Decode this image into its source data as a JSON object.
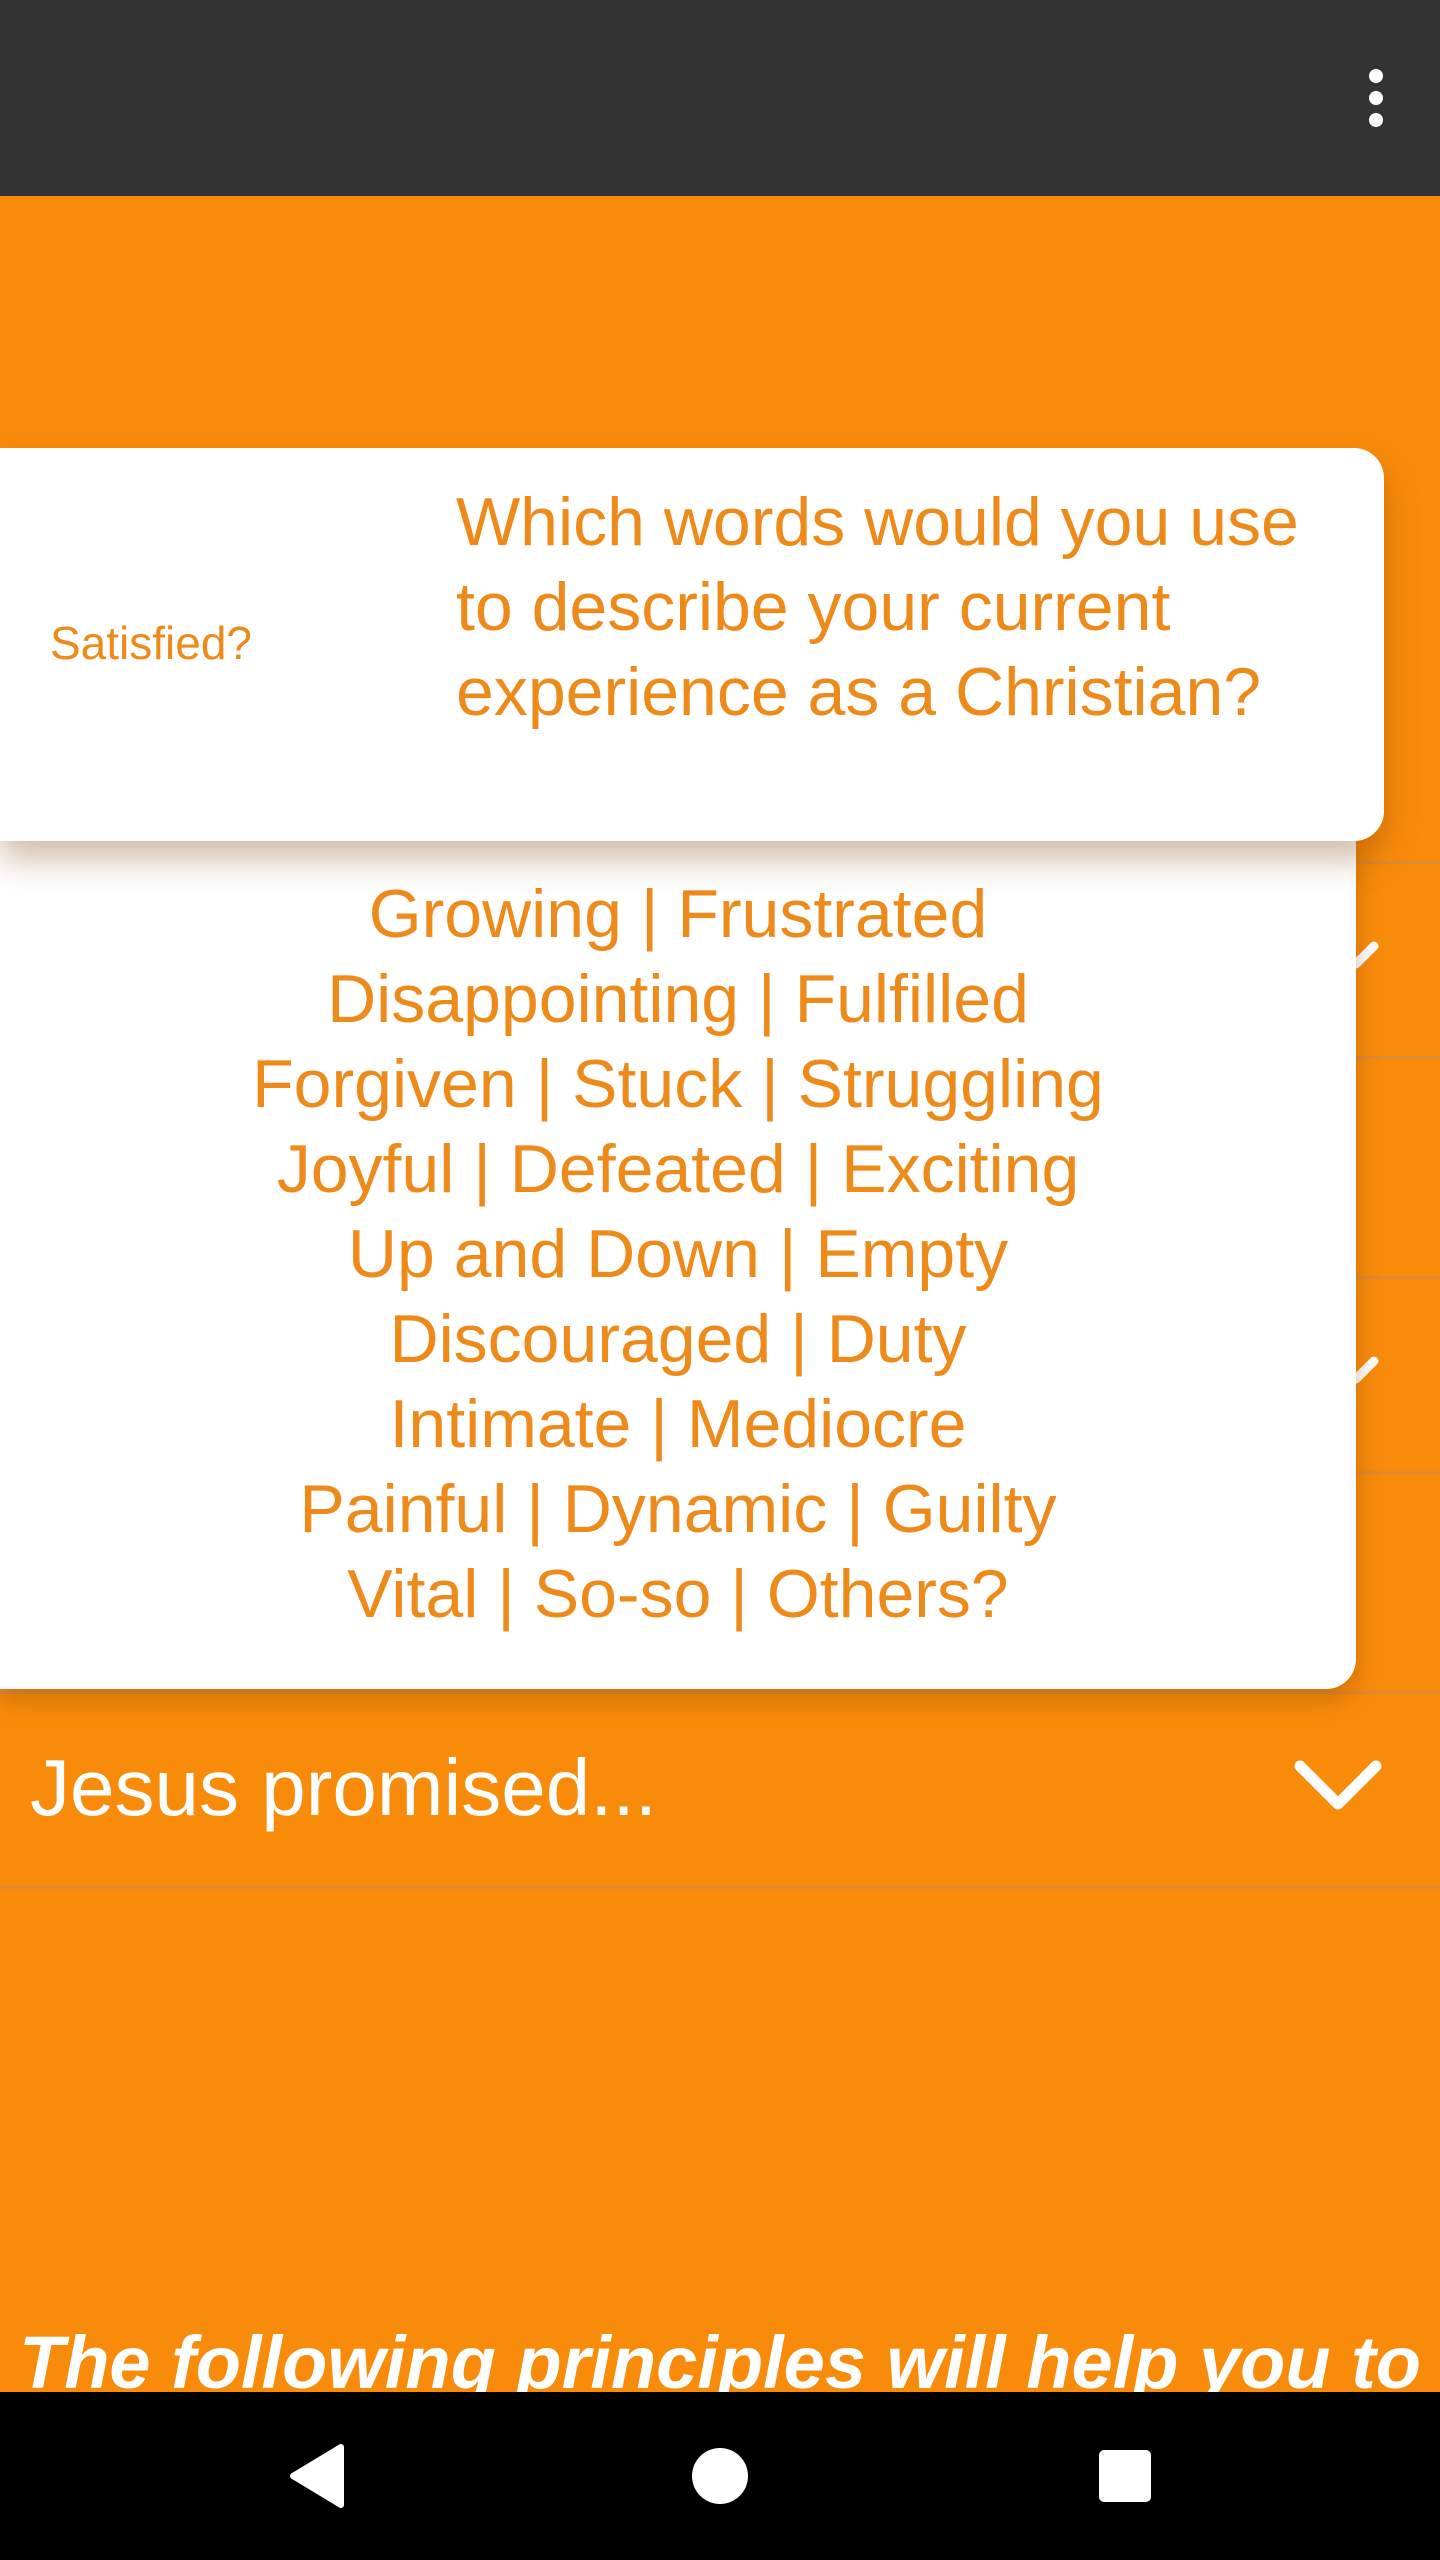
{
  "app_bar": {
    "background": "#333333",
    "menu_icon": "more-vert-icon"
  },
  "colors": {
    "accent": "#F98B0B",
    "card_text": "#EE8A1A",
    "card_background": "#FFFFFF"
  },
  "dialog": {
    "label": "Satisfied?",
    "question": "Which words would you use to describe your current experience as a Christian?",
    "words": [
      "Growing | Frustrated",
      "Disappointing | Fulfilled",
      "Forgiven | Stuck | Struggling",
      "Joyful | Defeated | Exciting",
      "Up and Down | Empty",
      "Discouraged | Duty",
      "Intimate | Mediocre",
      "Painful | Dynamic | Guilty",
      "Vital | So-so | Others?"
    ]
  },
  "accordion": {
    "items": [
      {
        "label": "Jesus promised...",
        "icon": "chevron-down-icon"
      }
    ]
  },
  "footer_text": "The following principles will help you to understand and enjoy God's Spirit.",
  "nav_bar": {
    "back_icon": "back-triangle-icon",
    "home_icon": "home-circle-icon",
    "recents_icon": "recents-square-icon"
  }
}
